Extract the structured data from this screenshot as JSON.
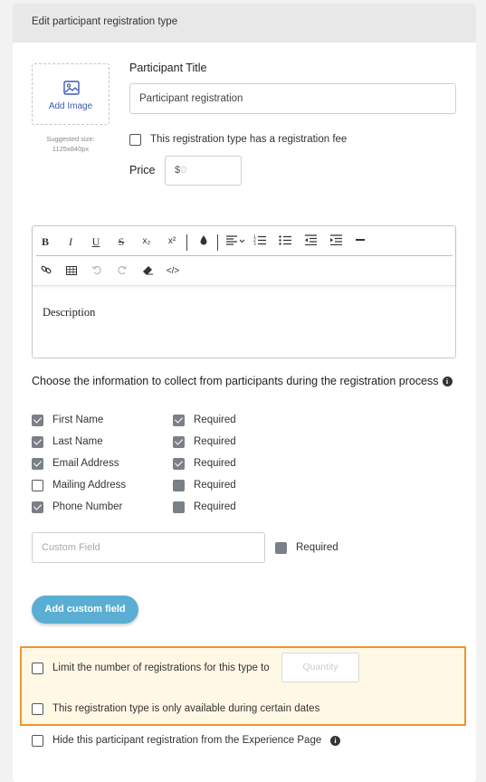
{
  "header": {
    "title": "Edit participant registration type"
  },
  "image": {
    "add_label": "Add Image",
    "suggested": "Suggested size: 1125x840px"
  },
  "participant": {
    "title_label": "Participant Title",
    "title_value": "Participant registration"
  },
  "fee": {
    "label": "This registration type has a registration fee",
    "checked": false
  },
  "price": {
    "label": "Price",
    "currency": "$",
    "placeholder": "0"
  },
  "editor": {
    "toolbar_row1": [
      "B",
      "I",
      "U",
      "S",
      "x₂",
      "x²",
      "drop-icon",
      "align-icon",
      "ordered-list-icon",
      "bullet-list-icon",
      "outdent-icon",
      "indent-icon",
      "hr-icon"
    ],
    "toolbar_row2": [
      "link-icon",
      "table-icon",
      "undo-icon",
      "redo-icon",
      "eraser-icon",
      "code-icon"
    ],
    "content": "Description"
  },
  "collect": {
    "heading": "Choose the information to collect from participants during the registration process",
    "fields": [
      {
        "label": "First Name",
        "checked": true,
        "required_label": "Required",
        "required": true
      },
      {
        "label": "Last Name",
        "checked": true,
        "required_label": "Required",
        "required": true
      },
      {
        "label": "Email Address",
        "checked": true,
        "required_label": "Required",
        "required": true
      },
      {
        "label": "Mailing Address",
        "checked": false,
        "required_label": "Required",
        "required": false
      },
      {
        "label": "Phone Number",
        "checked": true,
        "required_label": "Required",
        "required": false
      }
    ],
    "custom_placeholder": "Custom Field",
    "custom_required_label": "Required",
    "add_button": "Add custom field"
  },
  "options": {
    "limit_label": "Limit the number of registrations for this type to",
    "quantity_placeholder": "Quantity",
    "dates_label": "This registration type is only available during certain dates",
    "hide_label": "Hide this participant registration from the Experience Page"
  },
  "colors": {
    "accent": "#5aaed3",
    "highlight_border": "#f0952e",
    "highlight_bg": "#fff8e5",
    "link": "#3a5bb8"
  }
}
